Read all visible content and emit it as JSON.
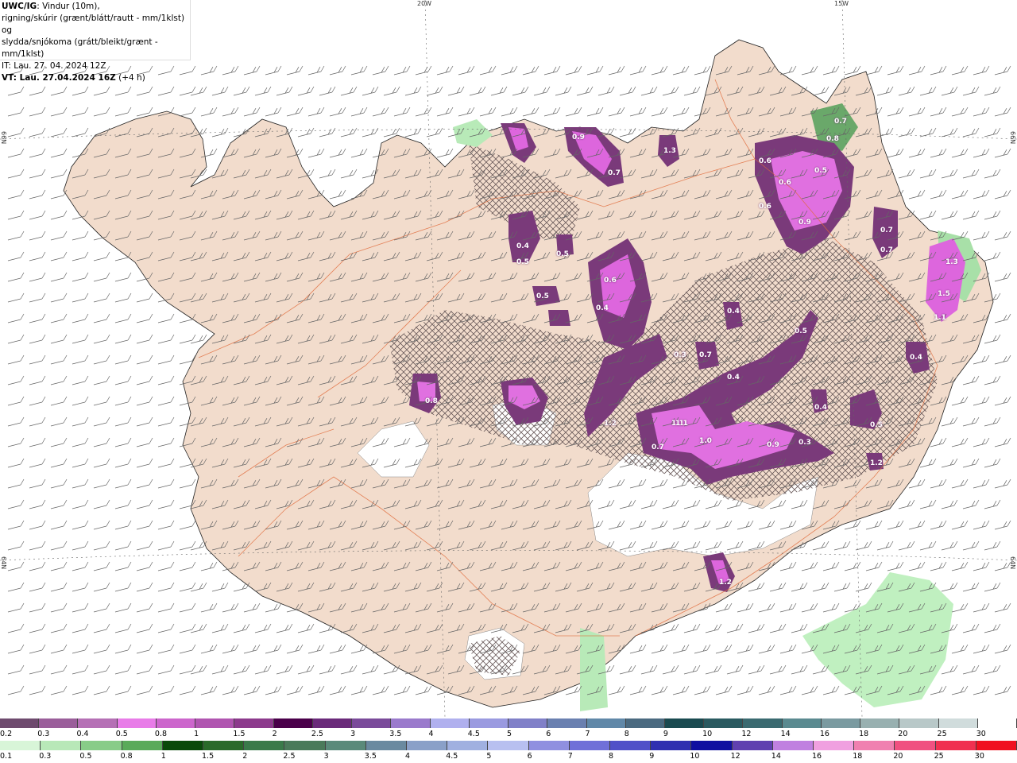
{
  "header": {
    "model": "UWC/IG",
    "line1": ": Vindur (10m),",
    "line2": "rigning/skúrir (grænt/blátt/rautt - mm/1klst) og",
    "line3": "slydda/snjókoma (grátt/bleikt/grænt - mm/1klst)",
    "issue_time": "IT: Lau. 27. 04. 2024 12Z",
    "valid_time": "VT: Lau. 27.04.2024 16Z",
    "offset": "(+4 h)"
  },
  "grid_labels": {
    "lon_20w": "20W",
    "lon_15w": "15W",
    "lat_66n_left": "66N",
    "lat_66n_right": "66N",
    "lat_64n_left": "64N",
    "lat_64n_right": "64N"
  },
  "value_labels": [
    "0.9",
    "0.6",
    "0.7",
    "0.8",
    "1.3",
    "0.6",
    "0.5",
    "0.9",
    "1.1",
    "0.7",
    "0.4",
    "0.5",
    "0.5",
    "0.5",
    "0.4",
    "0.6",
    "0.3",
    "0.7",
    "0.4",
    "0.5",
    "0.8",
    "0.7",
    "1.2",
    "1.1",
    "0.7",
    "1.0",
    "0.9",
    "0.3",
    "0.4",
    "1.2",
    "0.5",
    "0.4",
    "1.5",
    "1.1",
    "1.3",
    "0.4",
    "0.7",
    "0.7",
    "0.6",
    "1.2"
  ],
  "legend_snow": {
    "labels": [
      "0.2",
      "0.3",
      "0.4",
      "0.5",
      "0.8",
      "1",
      "1.5",
      "2",
      "2.5",
      "3",
      "3.5",
      "4",
      "4.5",
      "5",
      "6",
      "7",
      "8",
      "9",
      "10",
      "12",
      "14",
      "16",
      "18",
      "20",
      "25",
      "30"
    ],
    "colors": [
      "#6e4a6e",
      "#9a5e9a",
      "#b570b5",
      "#e87ce8",
      "#cc66cc",
      "#b055b0",
      "#8c3a8c",
      "#4a004a",
      "#6a2a7a",
      "#7a4a9a",
      "#9a7acc",
      "#b0b0ee",
      "#9a9ae0",
      "#8080c8",
      "#6a80b0",
      "#6088a8",
      "#4a6a80",
      "#1a4a50",
      "#2a5a60",
      "#3a6a70",
      "#5a8a90",
      "#7a9aa0",
      "#98b0b0",
      "#b8c8c8",
      "#d0dcdc",
      "#ffffff"
    ]
  },
  "legend_rain": {
    "labels": [
      "0.1",
      "0.3",
      "0.5",
      "0.8",
      "1",
      "1.5",
      "2",
      "2.5",
      "3",
      "3.5",
      "4",
      "4.5",
      "5",
      "6",
      "7",
      "8",
      "9",
      "10",
      "12",
      "14",
      "16",
      "18",
      "20",
      "25",
      "30"
    ],
    "colors": [
      "#d8f5d8",
      "#b8e8b8",
      "#88cc88",
      "#5aaa5a",
      "#0a4a0a",
      "#2a6a2a",
      "#3a7a4a",
      "#4a7a5a",
      "#5a8a7a",
      "#6a8aa0",
      "#8aa0c8",
      "#a0b0e0",
      "#b8c0f0",
      "#9090e0",
      "#7070d8",
      "#5050c8",
      "#3030b0",
      "#1010a0",
      "#6040b0",
      "#c080e0",
      "#f0a0e0",
      "#f080b0",
      "#f05080",
      "#f03050",
      "#f01020"
    ]
  }
}
